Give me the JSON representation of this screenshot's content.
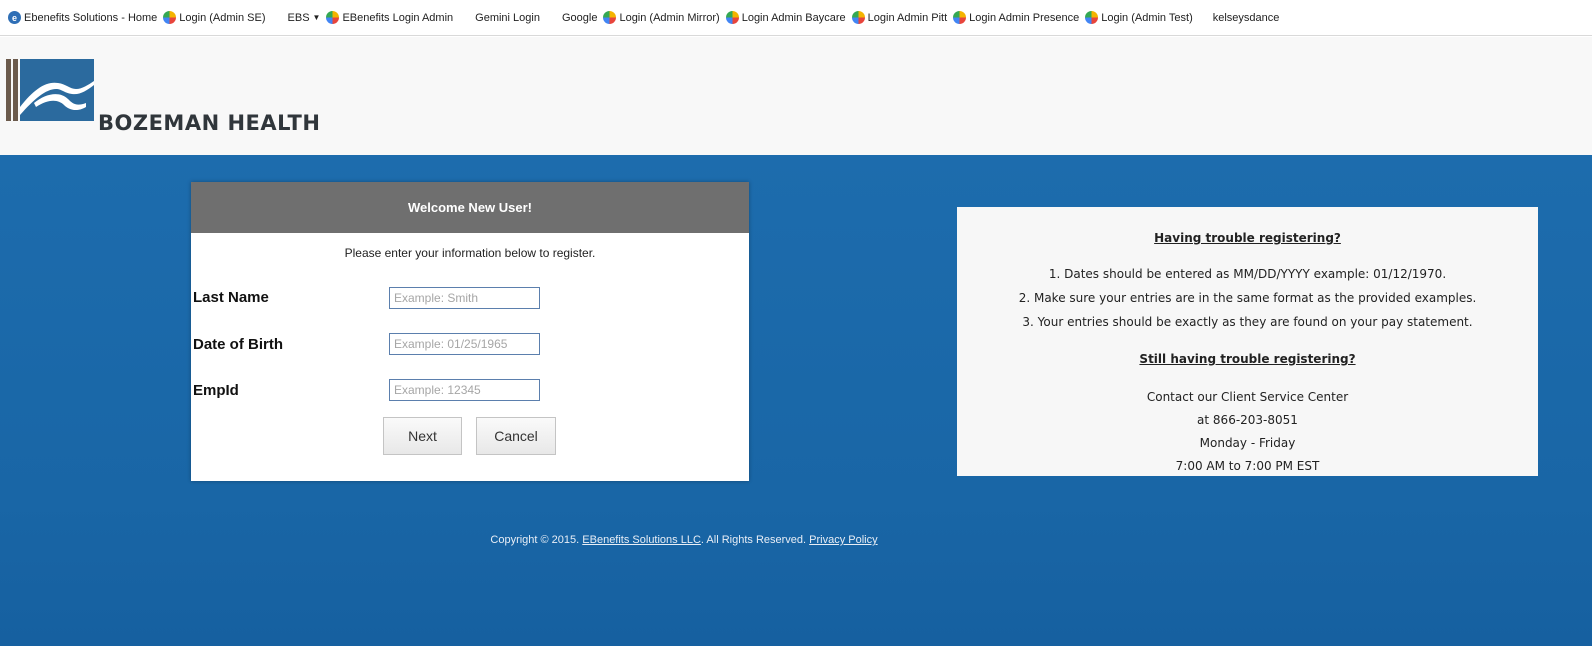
{
  "bookmarks": [
    {
      "icon": "ebenefits-icon",
      "label": "Ebenefits Solutions - Home"
    },
    {
      "icon": "login-icon",
      "label": "Login (Admin SE)"
    },
    {
      "icon": "ebs-icon",
      "label": "EBS"
    },
    {
      "icon": "login-icon",
      "label": "EBenefits Login Admin"
    },
    {
      "icon": "gemini-icon",
      "label": "Gemini Login"
    },
    {
      "icon": "google-icon",
      "label": "Google"
    },
    {
      "icon": "login-icon",
      "label": "Login (Admin Mirror)"
    },
    {
      "icon": "login-icon",
      "label": "Login Admin Baycare"
    },
    {
      "icon": "login-icon",
      "label": "Login Admin Pitt"
    },
    {
      "icon": "login-icon",
      "label": "Login Admin Presence"
    },
    {
      "icon": "login-icon",
      "label": "Login (Admin Test)"
    },
    {
      "icon": "",
      "label": "kelseysdance"
    }
  ],
  "header": {
    "brand": "BOZEMAN HEALTH"
  },
  "registration": {
    "title": "Welcome New User!",
    "instructions": "Please enter your information below to register.",
    "fields": [
      {
        "label": "Last Name",
        "placeholder": "Example: Smith",
        "value": ""
      },
      {
        "label": "Date of Birth",
        "placeholder": "Example: 01/25/1965",
        "value": ""
      },
      {
        "label": "EmpId",
        "placeholder": "Example: 12345",
        "value": ""
      }
    ],
    "next_label": "Next",
    "cancel_label": "Cancel"
  },
  "help": {
    "title": "Having trouble registering?",
    "tips": [
      "1. Dates should be entered as MM/DD/YYYY example: 01/12/1970.",
      "2. Make sure your entries are in the same format as the provided examples.",
      "3. Your entries should be exactly as they are found on your pay statement."
    ],
    "title2": "Still having trouble registering?",
    "contact": [
      "Contact our Client Service Center",
      "at 866-203-8051",
      "Monday - Friday",
      "7:00 AM to 7:00 PM EST"
    ]
  },
  "footer": {
    "copyright": "Copyright © 2015.",
    "company_link": "EBenefits Solutions LLC",
    "rights": ". All Rights Reserved.",
    "privacy_link": "Privacy Policy"
  },
  "colors": {
    "main_blue": "#1d6cad",
    "panel_header": "#6f6f6f"
  }
}
